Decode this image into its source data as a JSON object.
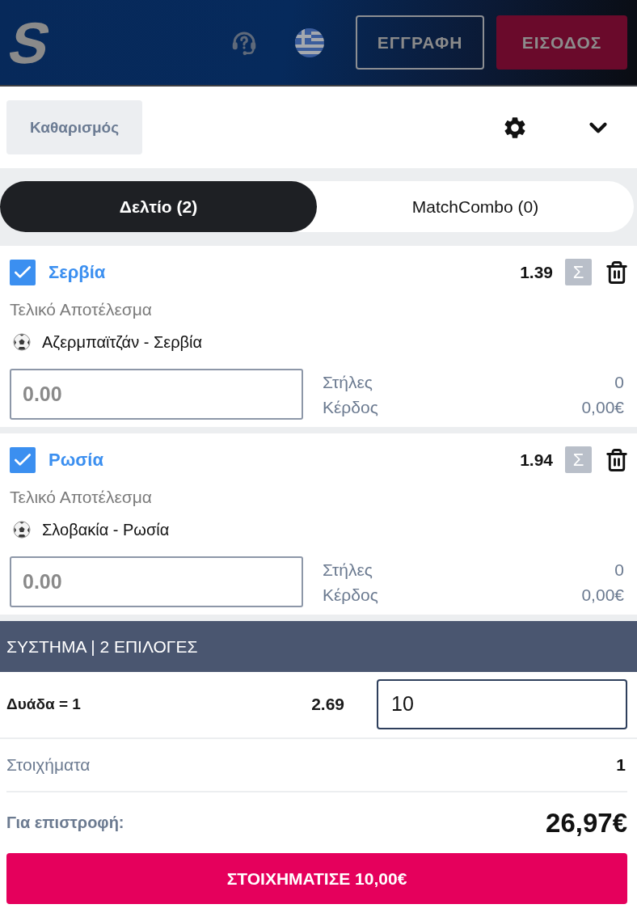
{
  "header": {
    "logo": "S",
    "register_button": "ΕΓΓΡΑΦΗ",
    "login_button": "ΕΙΣΟΔΟΣ"
  },
  "toolbar": {
    "clear_button": "Καθαρισμός"
  },
  "tabs": [
    {
      "label": "Δελτίο (2)",
      "selected": true
    },
    {
      "label": "MatchCombo (0)",
      "selected": false
    }
  ],
  "selections": [
    {
      "checked": true,
      "name": "Σερβία",
      "odds": "1.39",
      "system_mark": "Σ",
      "market": "Τελικό Αποτέλεσμα",
      "event": "Αζερμπαϊτζάν - Σερβία",
      "stake": {
        "placeholder": "0.00"
      },
      "stats": [
        {
          "label": "Στήλες",
          "value": "0"
        },
        {
          "label": "Κέρδος",
          "value": "0,00€"
        }
      ]
    },
    {
      "checked": true,
      "name": "Ρωσία",
      "odds": "1.94",
      "system_mark": "Σ",
      "market": "Τελικό Αποτέλεσμα",
      "event": "Σλοβακία - Ρωσία",
      "stake": {
        "placeholder": "0.00"
      },
      "stats": [
        {
          "label": "Στήλες",
          "value": "0"
        },
        {
          "label": "Κέρδος",
          "value": "0,00€"
        }
      ]
    }
  ],
  "system": {
    "title": "ΣΥΣΤΗΜΑ | 2 ΕΠΙΛΟΓΕΣ",
    "rows": [
      {
        "label": "Δυάδα = 1",
        "odds": "2.69",
        "stake": "10"
      }
    ]
  },
  "summary": [
    {
      "kind": "count",
      "label": "Στοιχήματα",
      "value": "1"
    },
    {
      "kind": "total",
      "label": "Για επιστροφή:",
      "value": "26,97€"
    }
  ],
  "place_bet_button": "ΣΤΟΙΧΗΜΑΤΙΣΕ 10,00€"
}
